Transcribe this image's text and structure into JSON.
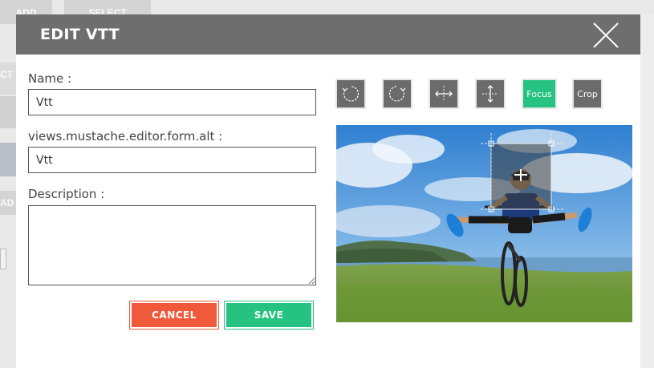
{
  "background": {
    "add_label": "ADD",
    "select_label": "SELECT",
    "left_labels": [
      "CT",
      "",
      "",
      "AD"
    ]
  },
  "modal": {
    "title": "EDIT VTT",
    "fields": {
      "name_label": "Name :",
      "name_value": "Vtt",
      "alt_label": "views.mustache.editor.form.alt :",
      "alt_value": "Vtt",
      "description_label": "Description :",
      "description_value": ""
    },
    "buttons": {
      "cancel": "CANCEL",
      "save": "SAVE"
    },
    "toolbar": {
      "rotate_left": "rotate-left-icon",
      "rotate_right": "rotate-right-icon",
      "flip_horizontal": "flip-horizontal-icon",
      "flip_vertical": "flip-vertical-icon",
      "focus_label": "Focus",
      "crop_label": "Crop"
    },
    "colors": {
      "header": "#6e6e6e",
      "cancel": "#f0593a",
      "save": "#26c281",
      "tool": "#6b6b6b",
      "focus_active": "#26c281"
    }
  }
}
